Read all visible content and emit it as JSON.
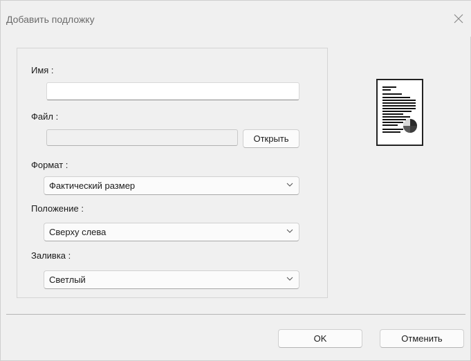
{
  "dialog": {
    "title": "Добавить подложку",
    "close_icon": "close-icon"
  },
  "form": {
    "name_label": "Имя :",
    "name_value": "",
    "file_label": "Файл :",
    "file_value": "",
    "open_button": "Открыть",
    "format_label": "Формат :",
    "format_value": "Фактический размер",
    "position_label": "Положение :",
    "position_value": "Сверху слева",
    "fill_label": "Заливка :",
    "fill_value": "Светлый"
  },
  "footer": {
    "ok_label": "OK",
    "cancel_label": "Отменить"
  }
}
